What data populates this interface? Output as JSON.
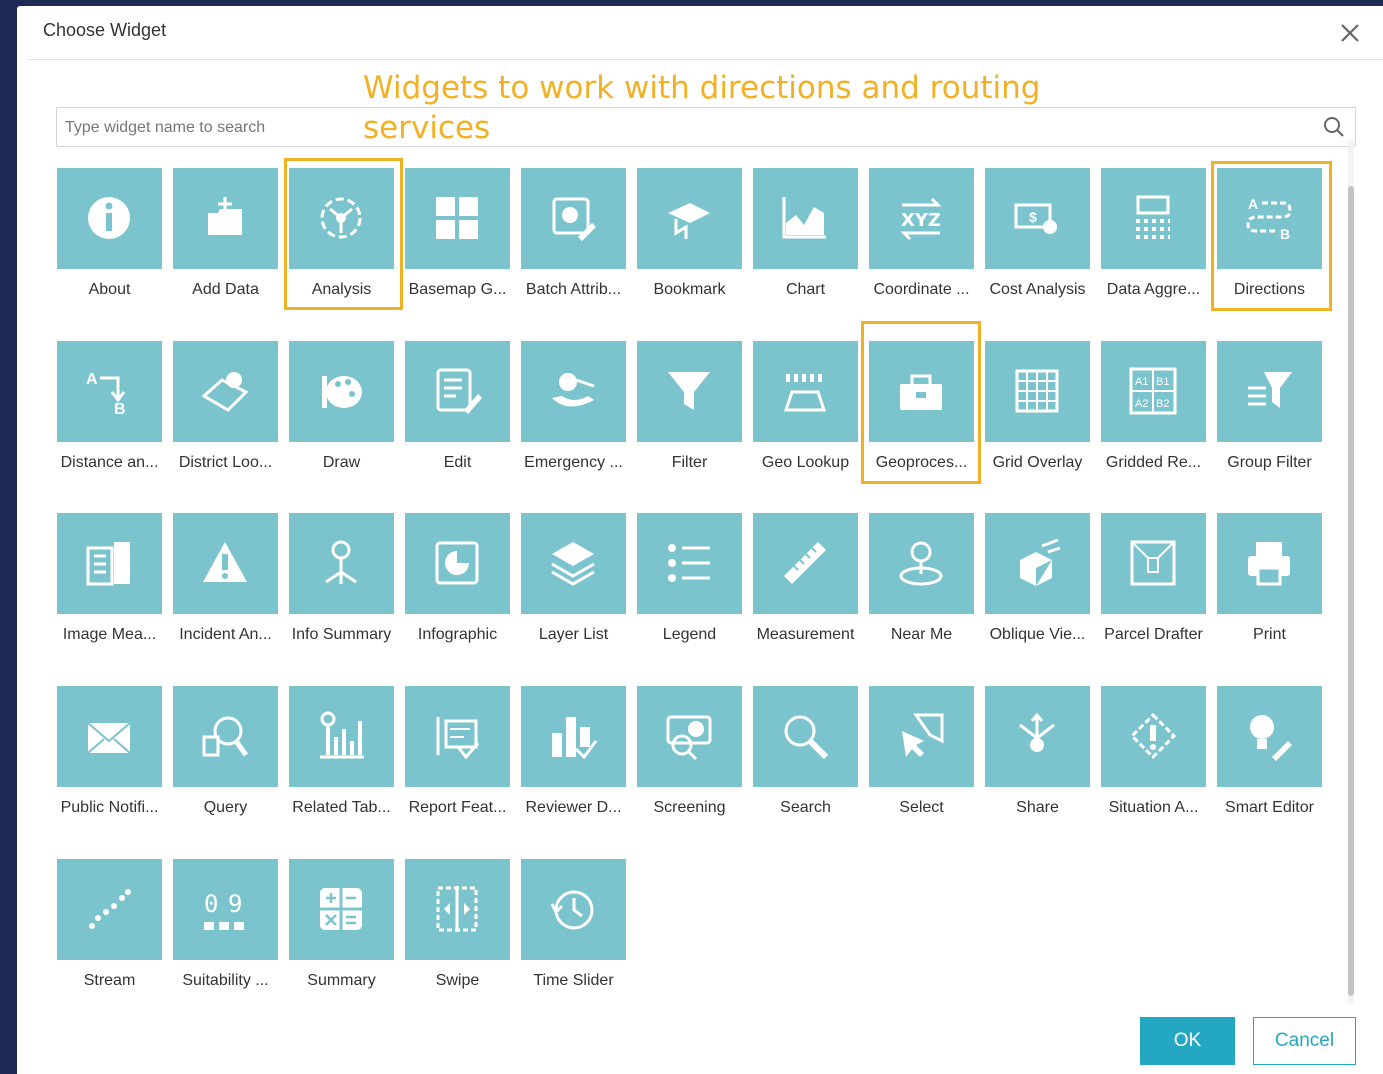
{
  "dialog": {
    "title": "Choose Widget",
    "annotation": "Widgets to work with directions and routing services",
    "search_placeholder": "Type widget name to search",
    "ok_label": "OK",
    "cancel_label": "Cancel"
  },
  "colors": {
    "tile": "#7cc4cd",
    "highlight": "#f2b124",
    "accent": "#24a7c3"
  },
  "widgets": [
    {
      "label": "About",
      "icon": "info-icon"
    },
    {
      "label": "Add Data",
      "icon": "add-data-icon"
    },
    {
      "label": "Analysis",
      "icon": "analysis-icon"
    },
    {
      "label": "Basemap G...",
      "icon": "basemap-gallery-icon"
    },
    {
      "label": "Batch Attrib...",
      "icon": "batch-attribute-icon"
    },
    {
      "label": "Bookmark",
      "icon": "bookmark-icon"
    },
    {
      "label": "Chart",
      "icon": "chart-icon"
    },
    {
      "label": "Coordinate ...",
      "icon": "coordinate-icon"
    },
    {
      "label": "Cost Analysis",
      "icon": "cost-analysis-icon"
    },
    {
      "label": "Data Aggre...",
      "icon": "data-aggregation-icon"
    },
    {
      "label": "Directions",
      "icon": "directions-icon"
    },
    {
      "label": "Distance an...",
      "icon": "distance-direction-icon"
    },
    {
      "label": "District Loo...",
      "icon": "district-lookup-icon"
    },
    {
      "label": "Draw",
      "icon": "draw-palette-icon"
    },
    {
      "label": "Edit",
      "icon": "edit-icon"
    },
    {
      "label": "Emergency ...",
      "icon": "emergency-icon"
    },
    {
      "label": "Filter",
      "icon": "filter-icon"
    },
    {
      "label": "Geo Lookup",
      "icon": "geo-lookup-icon"
    },
    {
      "label": "Geoproces...",
      "icon": "geoprocessing-toolbox-icon"
    },
    {
      "label": "Grid Overlay",
      "icon": "grid-overlay-icon"
    },
    {
      "label": "Gridded Re...",
      "icon": "gridded-reference-icon"
    },
    {
      "label": "Group Filter",
      "icon": "group-filter-icon"
    },
    {
      "label": "Image Mea...",
      "icon": "image-measurement-icon"
    },
    {
      "label": "Incident An...",
      "icon": "incident-analysis-icon"
    },
    {
      "label": "Info Summary",
      "icon": "info-summary-icon"
    },
    {
      "label": "Infographic",
      "icon": "infographic-icon"
    },
    {
      "label": "Layer List",
      "icon": "layer-list-icon"
    },
    {
      "label": "Legend",
      "icon": "legend-icon"
    },
    {
      "label": "Measurement",
      "icon": "ruler-icon"
    },
    {
      "label": "Near Me",
      "icon": "near-me-icon"
    },
    {
      "label": "Oblique Vie...",
      "icon": "oblique-viewer-icon"
    },
    {
      "label": "Parcel Drafter",
      "icon": "parcel-drafter-icon"
    },
    {
      "label": "Print",
      "icon": "printer-icon"
    },
    {
      "label": "Public Notifi...",
      "icon": "envelope-icon"
    },
    {
      "label": "Query",
      "icon": "query-icon"
    },
    {
      "label": "Related Tab...",
      "icon": "related-table-icon"
    },
    {
      "label": "Report Feat...",
      "icon": "report-feature-icon"
    },
    {
      "label": "Reviewer D...",
      "icon": "reviewer-dashboard-icon"
    },
    {
      "label": "Screening",
      "icon": "screening-icon"
    },
    {
      "label": "Search",
      "icon": "magnifier-icon"
    },
    {
      "label": "Select",
      "icon": "select-icon"
    },
    {
      "label": "Share",
      "icon": "share-icon"
    },
    {
      "label": "Situation A...",
      "icon": "situation-awareness-icon"
    },
    {
      "label": "Smart Editor",
      "icon": "smart-editor-icon"
    },
    {
      "label": "Stream",
      "icon": "stream-icon"
    },
    {
      "label": "Suitability ...",
      "icon": "suitability-icon"
    },
    {
      "label": "Summary",
      "icon": "calculator-icon"
    },
    {
      "label": "Swipe",
      "icon": "swipe-icon"
    },
    {
      "label": "Time Slider",
      "icon": "clock-icon"
    }
  ]
}
